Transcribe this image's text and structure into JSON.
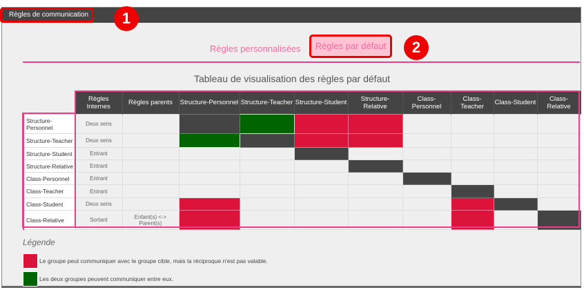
{
  "window": {
    "title": "Règles de communication"
  },
  "annotations": [
    "1",
    "2"
  ],
  "tabs": [
    {
      "label": "Règles personnalisées",
      "active": false
    },
    {
      "label": "Règles par défaut",
      "active": true
    }
  ],
  "table": {
    "title": "Tableau de visualisation des règles par défaut",
    "headers": [
      "Règles Internes",
      "Règles parents",
      "Structure-Personnel",
      "Structure-Teacher",
      "Structure-Student",
      "Structure-Relative",
      "Class-Personnel",
      "Class-Teacher",
      "Class-Student",
      "Class-Relative"
    ],
    "rows": [
      {
        "label": "Structure-Personnel",
        "internes": "Deux sens",
        "parents": "",
        "cells": [
          "d",
          "g",
          "r",
          "r",
          "",
          "",
          "",
          ""
        ]
      },
      {
        "label": "Structure-Teacher",
        "internes": "Deux sens",
        "parents": "",
        "cells": [
          "g",
          "d",
          "r",
          "r",
          "",
          "",
          "",
          ""
        ]
      },
      {
        "label": "Structure-Student",
        "internes": "Entrant",
        "parents": "",
        "cells": [
          "",
          "",
          "d",
          "",
          "",
          "",
          "",
          ""
        ]
      },
      {
        "label": "Structure-Relative",
        "internes": "Entrant",
        "parents": "",
        "cells": [
          "",
          "",
          "",
          "d",
          "",
          "",
          "",
          ""
        ]
      },
      {
        "label": "Class-Personnel",
        "internes": "Entrant",
        "parents": "",
        "cells": [
          "",
          "",
          "",
          "",
          "d",
          "",
          "",
          ""
        ]
      },
      {
        "label": "Class-Teacher",
        "internes": "Entrant",
        "parents": "",
        "cells": [
          "",
          "",
          "",
          "",
          "",
          "d",
          "",
          ""
        ]
      },
      {
        "label": "Class-Student",
        "internes": "Deux sens",
        "parents": "",
        "cells": [
          "r",
          "",
          "",
          "",
          "",
          "r",
          "d",
          ""
        ]
      },
      {
        "label": "Class-Relative",
        "internes": "Sortant",
        "parents": "Enfant(s) <-> Parent(s)",
        "cells": [
          "r",
          "",
          "",
          "",
          "",
          "r",
          "",
          "d"
        ]
      }
    ]
  },
  "colors": {
    "d": "#444444",
    "g": "#006400",
    "r": "#dc143c",
    "accent": "#ef3c86"
  },
  "legend": {
    "title": "Légende",
    "items": [
      {
        "color": "#dc143c",
        "text": "Le groupe peut communiquer avec le groupe cible, mais la réciproque n'est pas valable."
      },
      {
        "color": "#006400",
        "text": "Les deux groupes peuvent communiquer entre eux."
      }
    ]
  }
}
